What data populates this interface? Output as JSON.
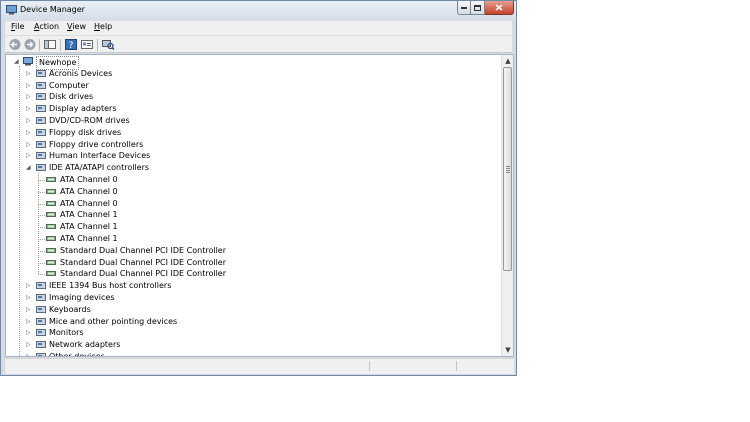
{
  "window": {
    "title": "Device Manager"
  },
  "menu": [
    {
      "key": "F",
      "rest": "ile"
    },
    {
      "key": "A",
      "rest": "ction"
    },
    {
      "key": "V",
      "rest": "iew"
    },
    {
      "key": "H",
      "rest": "elp"
    }
  ],
  "tree": {
    "root": "Newhope",
    "categories": [
      {
        "label": "Acronis Devices",
        "icon": "acronis-device-icon"
      },
      {
        "label": "Computer",
        "icon": "computer-icon"
      },
      {
        "label": "Disk drives",
        "icon": "disk-drive-icon"
      },
      {
        "label": "Display adapters",
        "icon": "display-adapter-icon"
      },
      {
        "label": "DVD/CD-ROM drives",
        "icon": "dvd-drive-icon"
      },
      {
        "label": "Floppy disk drives",
        "icon": "floppy-disk-icon"
      },
      {
        "label": "Floppy drive controllers",
        "icon": "floppy-controller-icon"
      },
      {
        "label": "Human Interface Devices",
        "icon": "hid-icon"
      },
      {
        "label": "IDE ATA/ATAPI controllers",
        "icon": "ide-controller-icon",
        "expanded": true,
        "children": [
          "ATA Channel 0",
          "ATA Channel 0",
          "ATA Channel 0",
          "ATA Channel 1",
          "ATA Channel 1",
          "ATA Channel 1",
          "Standard Dual Channel PCI IDE Controller",
          "Standard Dual Channel PCI IDE Controller",
          "Standard Dual Channel PCI IDE Controller"
        ]
      },
      {
        "label": "IEEE 1394 Bus host controllers",
        "icon": "ieee1394-icon"
      },
      {
        "label": "Imaging devices",
        "icon": "imaging-device-icon"
      },
      {
        "label": "Keyboards",
        "icon": "keyboard-icon"
      },
      {
        "label": "Mice and other pointing devices",
        "icon": "mouse-icon"
      },
      {
        "label": "Monitors",
        "icon": "monitor-icon"
      },
      {
        "label": "Network adapters",
        "icon": "network-adapter-icon"
      },
      {
        "label": "Other devices",
        "icon": "other-devices-icon"
      }
    ]
  },
  "colors": {
    "accent": "#3a6ea5",
    "close": "#c3422c"
  }
}
